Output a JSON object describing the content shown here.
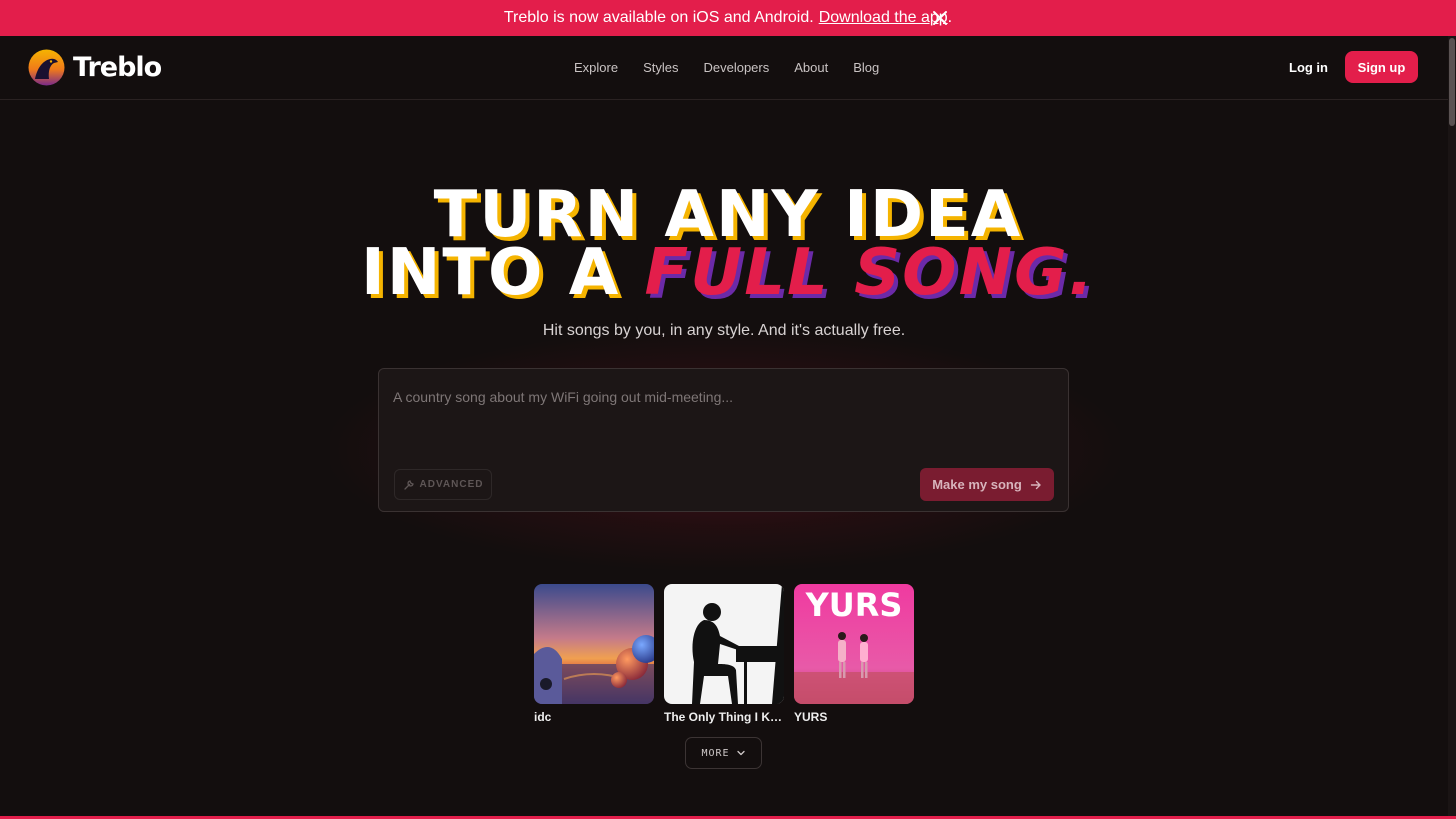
{
  "banner": {
    "text": "Treblo is now available on iOS and Android.",
    "link": "Download the app",
    "suffix": "."
  },
  "nav": {
    "brand": "Treblo",
    "links": [
      "Explore",
      "Styles",
      "Developers",
      "About",
      "Blog"
    ],
    "login": "Log in",
    "signup": "Sign up"
  },
  "hero": {
    "line1": "TURN ANY IDEA",
    "line2_white": "INTO A ",
    "line2_red": "FULL SONG.",
    "subtitle": "Hit songs by you, in any style. And it's actually free."
  },
  "prompt": {
    "placeholder": "A country song about my WiFi going out mid-meeting...",
    "advanced_label": "ADVANCED",
    "submit_label": "Make my song"
  },
  "songs": [
    {
      "title": "idc"
    },
    {
      "title": "The Only Thing I Know For Real"
    },
    {
      "title": "YURS",
      "cover_text": "YURS"
    }
  ],
  "more_label": "MORE",
  "colors": {
    "brand": "#e31e4b",
    "background": "#130e0e",
    "accent_yellow": "#f5b400",
    "accent_purple": "#6b2aa8"
  }
}
